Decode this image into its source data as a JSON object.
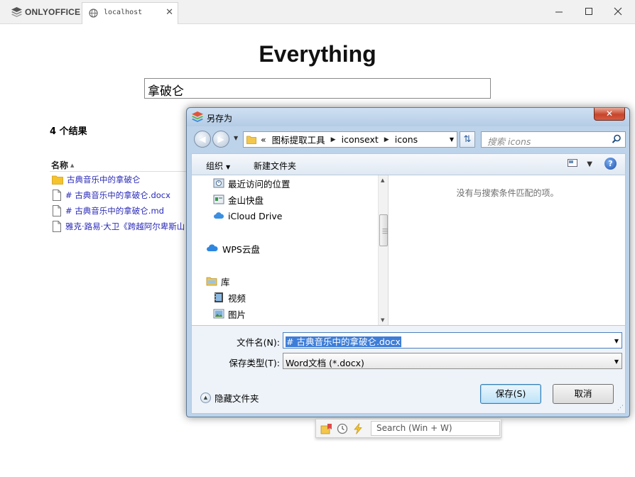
{
  "browser": {
    "brand": "ONLYOFFICE",
    "tab_title": "localhost",
    "tab_close": "✕",
    "window_minimize": "—",
    "window_close": "✕"
  },
  "page": {
    "title": "Everything",
    "search_value": "拿破仑",
    "result_count": "4 个结果",
    "column_name": "名称",
    "results": [
      {
        "type": "folder",
        "name": "古典音乐中的拿破仑"
      },
      {
        "type": "file",
        "name": "# 古典音乐中的拿破仑.docx"
      },
      {
        "type": "file",
        "name": "# 古典音乐中的拿破仑.md"
      },
      {
        "type": "file",
        "name": "雅克·路易·大卫《跨越阿尔卑斯山"
      }
    ]
  },
  "dialog": {
    "title": "另存为",
    "close": "✕",
    "address": {
      "prefix": "«",
      "segments": [
        "图标提取工具",
        "iconsext",
        "icons"
      ]
    },
    "search_placeholder": "搜索 icons",
    "toolbar": {
      "organize": "组织",
      "new_folder": "新建文件夹",
      "help": "?"
    },
    "nav_items": [
      {
        "label": "最近访问的位置",
        "icon": "recent-places-icon"
      },
      {
        "label": "金山快盘",
        "icon": "kuaipan-icon"
      },
      {
        "label": "iCloud Drive",
        "icon": "icloud-icon"
      },
      {
        "label": "WPS云盘",
        "icon": "wps-cloud-icon"
      },
      {
        "label": "库",
        "icon": "library-icon"
      },
      {
        "label": "视频",
        "icon": "video-icon"
      },
      {
        "label": "图片",
        "icon": "pictures-icon"
      }
    ],
    "empty_message": "没有与搜索条件匹配的项。",
    "filename_label": "文件名(N):",
    "filename_value": "# 古典音乐中的拿破仑.docx",
    "filetype_label": "保存类型(T):",
    "filetype_value": "Word文档 (*.docx)",
    "hide_folders": "隐藏文件夹",
    "save_button": "保存(S)",
    "cancel_button": "取消"
  },
  "everything_bar": {
    "search_placeholder": "Search (Win + W)"
  },
  "colors": {
    "link": "#2a2ab8",
    "folder": "#f5c32c",
    "dialog_frame": "#bcd3ea",
    "selection": "#3d7dd8"
  }
}
